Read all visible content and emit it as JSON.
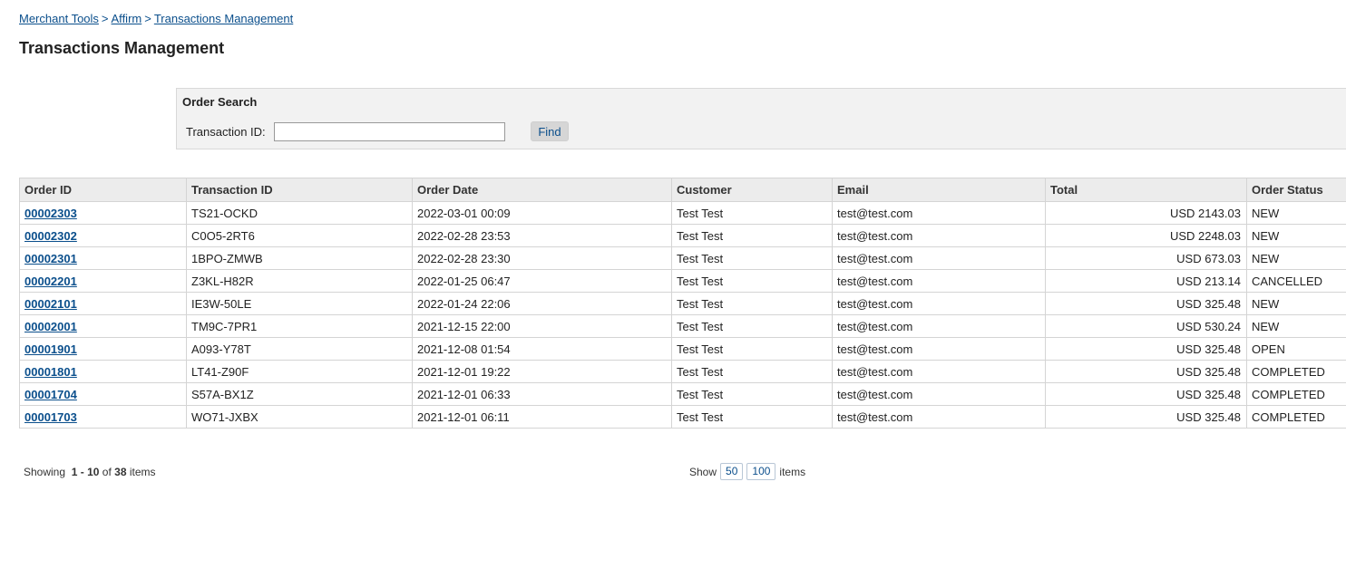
{
  "breadcrumb": {
    "items": [
      "Merchant Tools",
      "Affirm",
      "Transactions Management"
    ],
    "separator": ">"
  },
  "page_title": "Transactions Management",
  "search": {
    "title": "Order Search",
    "label": "Transaction ID:",
    "value": "",
    "placeholder": "",
    "button": "Find"
  },
  "table": {
    "columns": [
      "Order ID",
      "Transaction ID",
      "Order Date",
      "Customer",
      "Email",
      "Total",
      "Order Status"
    ],
    "rows": [
      [
        "00002303",
        "TS21-OCKD",
        "2022-03-01 00:09",
        "Test Test",
        "test@test.com",
        "USD 2143.03",
        "NEW"
      ],
      [
        "00002302",
        "C0O5-2RT6",
        "2022-02-28 23:53",
        "Test Test",
        "test@test.com",
        "USD 2248.03",
        "NEW"
      ],
      [
        "00002301",
        "1BPO-ZMWB",
        "2022-02-28 23:30",
        "Test Test",
        "test@test.com",
        "USD 673.03",
        "NEW"
      ],
      [
        "00002201",
        "Z3KL-H82R",
        "2022-01-25 06:47",
        "Test Test",
        "test@test.com",
        "USD 213.14",
        "CANCELLED"
      ],
      [
        "00002101",
        "IE3W-50LE",
        "2022-01-24 22:06",
        "Test Test",
        "test@test.com",
        "USD 325.48",
        "NEW"
      ],
      [
        "00002001",
        "TM9C-7PR1",
        "2021-12-15 22:00",
        "Test Test",
        "test@test.com",
        "USD 530.24",
        "NEW"
      ],
      [
        "00001901",
        "A093-Y78T",
        "2021-12-08 01:54",
        "Test Test",
        "test@test.com",
        "USD 325.48",
        "OPEN"
      ],
      [
        "00001801",
        "LT41-Z90F",
        "2021-12-01 19:22",
        "Test Test",
        "test@test.com",
        "USD 325.48",
        "COMPLETED"
      ],
      [
        "00001704",
        "S57A-BX1Z",
        "2021-12-01 06:33",
        "Test Test",
        "test@test.com",
        "USD 325.48",
        "COMPLETED"
      ],
      [
        "00001703",
        "WO71-JXBX",
        "2021-12-01 06:11",
        "Test Test",
        "test@test.com",
        "USD 325.48",
        "COMPLETED"
      ]
    ]
  },
  "pager": {
    "showing_label": "Showing",
    "range_start": "1",
    "range_sep": "-",
    "range_end": "10",
    "of_label": "of",
    "total": "38",
    "items_label": "items",
    "show_label": "Show",
    "sizes": [
      "50",
      "100"
    ],
    "sizes_items_label": "items"
  },
  "colors": {
    "link": "#0b4f8c",
    "header_bg": "#ececec",
    "panel_bg": "#f2f2f2"
  }
}
